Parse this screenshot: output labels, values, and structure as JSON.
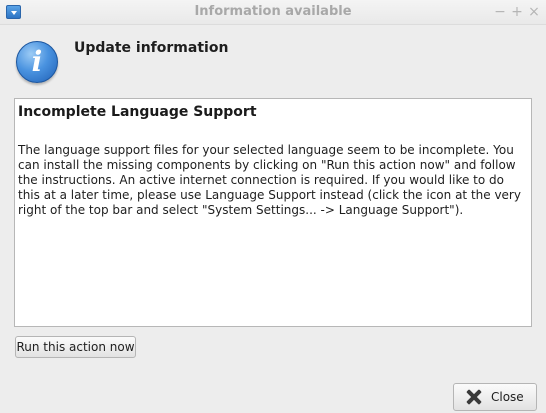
{
  "window": {
    "title": "Information available",
    "controls": {
      "minimize": "−",
      "maximize": "+",
      "close": "×"
    }
  },
  "header": {
    "icon": "info-icon",
    "icon_glyph": "i",
    "title": "Update information"
  },
  "message": {
    "title": "Incomplete Language Support",
    "body": "The language support files for your selected language seem to be incomplete. You can install the missing components by clicking on \"Run this action now\" and follow the instructions. An active internet connection is required. If you would like to do this at a later time, please use Language Support instead (click the icon at the very right of the top bar and select \"System Settings... -> Language Support\")."
  },
  "actions": {
    "run_label": "Run this action now",
    "close_label": "Close",
    "close_icon": "close-icon"
  },
  "colors": {
    "accent": "#2d74c4",
    "background": "#ededed"
  }
}
